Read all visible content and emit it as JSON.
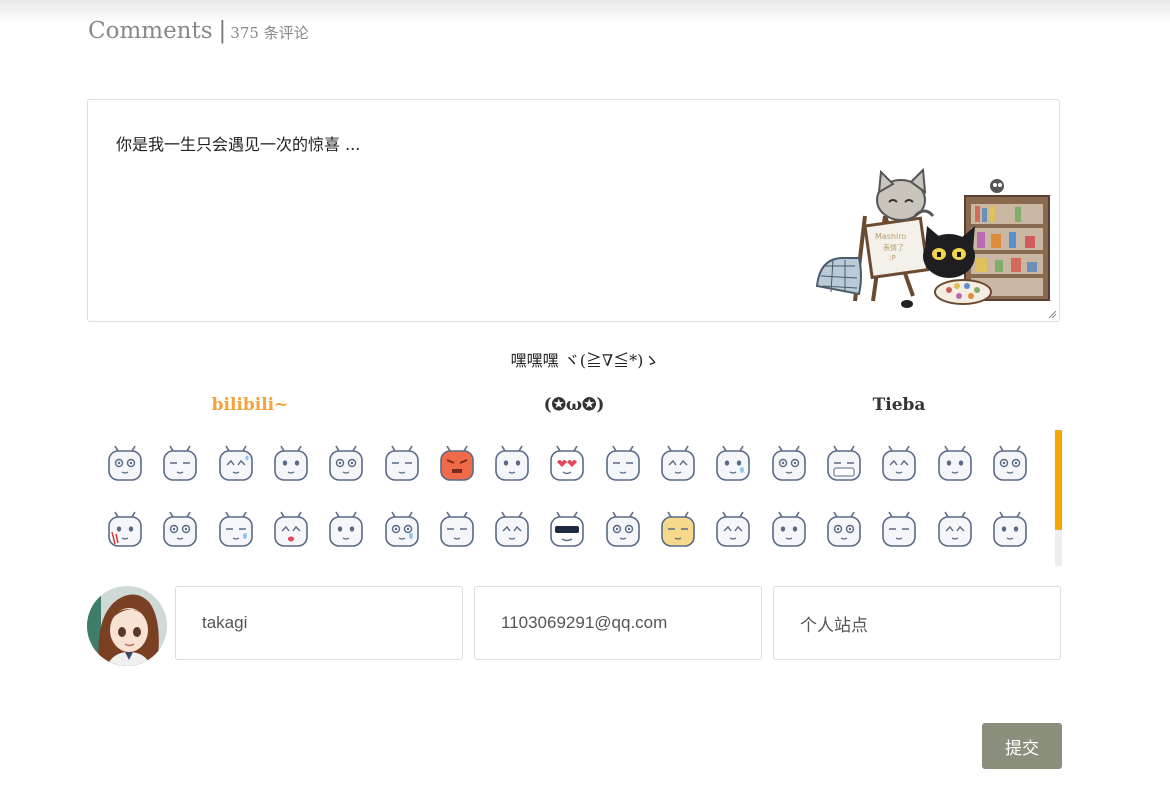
{
  "header": {
    "title": "Comments",
    "separator": "|",
    "count_label": "375 条评论"
  },
  "editor": {
    "placeholder": "你是我一生只会遇见一次的惊喜 ..."
  },
  "mascot": {
    "sign_line1": "Mashiro",
    "sign_line2": "表情了",
    "sign_line3": ":P"
  },
  "emoji_toggle": {
    "label": "嘿嘿嘿 ヾ(≧∇≦*)ゝ"
  },
  "emoji_tabs": [
    {
      "label": "bilibili~",
      "active": true
    },
    {
      "label": "(✪ω✪)",
      "active": false
    },
    {
      "label": "Tieba",
      "active": false
    }
  ],
  "emoji_rows": [
    [
      "face-round-eyes",
      "face-stare",
      "face-sweat",
      "face-squint",
      "face-cry",
      "face-smirk",
      "face-angry",
      "face-sleepy",
      "face-heart-eyes",
      "face-annoyed",
      "face-shush",
      "face-tear",
      "face-blank",
      "face-mask",
      "face-ghost",
      "face-surprised",
      "face-calm"
    ],
    [
      "face-bleeding",
      "face-frustrated",
      "face-sob",
      "face-shocked",
      "face-thinking",
      "face-tearful",
      "face-sleeping",
      "face-grin",
      "face-sunglasses",
      "face-content",
      "face-sick",
      "face-dizzy",
      "face-confused",
      "face-scared",
      "face-laugh",
      "face-smile",
      "face-wink"
    ]
  ],
  "form": {
    "name_value": "takagi",
    "email_value": "1103069291@qq.com",
    "site_placeholder": "个人站点",
    "submit_label": "提交"
  },
  "colors": {
    "accent": "#f2a33c",
    "scroll_thumb": "#f5a800",
    "submit_bg": "#8b8f7e",
    "border": "#dddddd"
  }
}
